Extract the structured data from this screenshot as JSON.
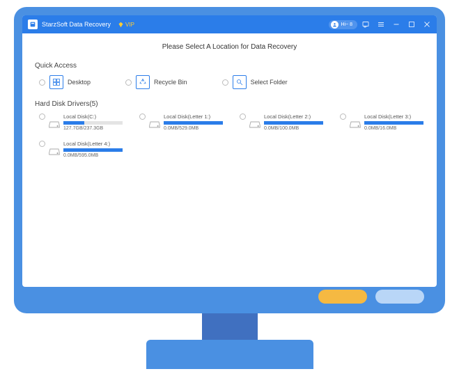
{
  "app": {
    "title": "StarzSoft Data Recovery",
    "vip": "VIP"
  },
  "user": {
    "label": "Hi~ 8"
  },
  "heading": "Please Select A Location for Data Recovery",
  "sections": {
    "quick_access": "Quick Access",
    "hard_disk": "Hard Disk Drivers(5)"
  },
  "quick_access": {
    "desktop": "Desktop",
    "recycle_bin": "Recycle Bin",
    "select_folder": "Select Folder"
  },
  "disks": {
    "d0": {
      "name": "Local Disk(C:)",
      "size": "127.7GB/237.3GB",
      "fill": "35%"
    },
    "d1": {
      "name": "Local Disk(Letter 1:)",
      "size": "0.0MB/529.0MB",
      "fill": "100%"
    },
    "d2": {
      "name": "Local Disk(Letter 2:)",
      "size": "0.0MB/100.0MB",
      "fill": "100%"
    },
    "d3": {
      "name": "Local Disk(Letter 3:)",
      "size": "0.0MB/16.0MB",
      "fill": "100%"
    },
    "d4": {
      "name": "Local Disk(Letter 4:)",
      "size": "0.0MB/595.0MB",
      "fill": "100%"
    }
  }
}
